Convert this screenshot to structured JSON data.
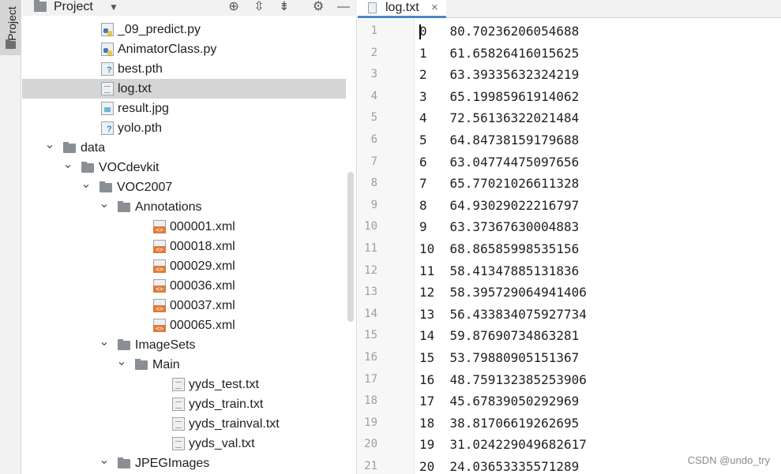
{
  "sidebar": {
    "tab_label": "Project",
    "tab_icon": "folder-icon"
  },
  "project_panel": {
    "title": "Project",
    "dropdown_icon": "chevron-down-icon",
    "toolbar_icons": [
      "locate-icon",
      "expand-all-icon",
      "collapse-all-icon",
      "gear-icon",
      "minimize-icon"
    ],
    "tree": [
      {
        "label": "_09_predict.py",
        "icon": "python-file-icon"
      },
      {
        "label": "AnimatorClass.py",
        "icon": "python-file-icon"
      },
      {
        "label": "best.pth",
        "icon": "unknown-file-icon"
      },
      {
        "label": "log.txt",
        "icon": "text-file-icon"
      },
      {
        "label": "result.jpg",
        "icon": "image-file-icon"
      },
      {
        "label": "yolo.pth",
        "icon": "unknown-file-icon"
      },
      {
        "label": "data",
        "icon": "folder-icon",
        "expanded": true
      },
      {
        "label": "VOCdevkit",
        "icon": "folder-icon",
        "expanded": true
      },
      {
        "label": "VOC2007",
        "icon": "folder-icon",
        "expanded": true
      },
      {
        "label": "Annotations",
        "icon": "folder-icon",
        "expanded": true
      },
      {
        "label": "000001.xml",
        "icon": "xml-file-icon"
      },
      {
        "label": "000018.xml",
        "icon": "xml-file-icon"
      },
      {
        "label": "000029.xml",
        "icon": "xml-file-icon"
      },
      {
        "label": "000036.xml",
        "icon": "xml-file-icon"
      },
      {
        "label": "000037.xml",
        "icon": "xml-file-icon"
      },
      {
        "label": "000065.xml",
        "icon": "xml-file-icon"
      },
      {
        "label": "ImageSets",
        "icon": "folder-icon",
        "expanded": true
      },
      {
        "label": "Main",
        "icon": "folder-icon",
        "expanded": true
      },
      {
        "label": "yyds_test.txt",
        "icon": "text-file-icon"
      },
      {
        "label": "yyds_train.txt",
        "icon": "text-file-icon"
      },
      {
        "label": "yyds_trainval.txt",
        "icon": "text-file-icon"
      },
      {
        "label": "yyds_val.txt",
        "icon": "text-file-icon"
      },
      {
        "label": "JPEGImages",
        "icon": "folder-icon",
        "expanded": true
      }
    ]
  },
  "editor": {
    "tab_label": "log.txt",
    "tab_close": "×",
    "line_numbers": [
      "1",
      "2",
      "3",
      "4",
      "5",
      "6",
      "7",
      "8",
      "9",
      "10",
      "11",
      "12",
      "13",
      "14",
      "15",
      "16",
      "17",
      "18",
      "19",
      "20",
      "21"
    ],
    "lines": [
      "0   80.70236206054688",
      "1   61.65826416015625",
      "2   63.39335632324219",
      "3   65.19985961914062",
      "4   72.56136322021484",
      "5   64.84738159179688",
      "6   63.04774475097656",
      "7   65.77021026611328",
      "8   64.93029022216797",
      "9   63.37367630004883",
      "10  68.86585998535156",
      "11  58.41347885131836",
      "12  58.395729064941406",
      "13  56.433834075927734",
      "14  59.87690734863281",
      "15  53.79880905151367",
      "16  48.759132385253906",
      "17  45.67839050292969",
      "18  38.81706619262695",
      "19  31.024229049682617",
      "20  24.03653335571289"
    ]
  },
  "watermark": "CSDN @undo_try"
}
